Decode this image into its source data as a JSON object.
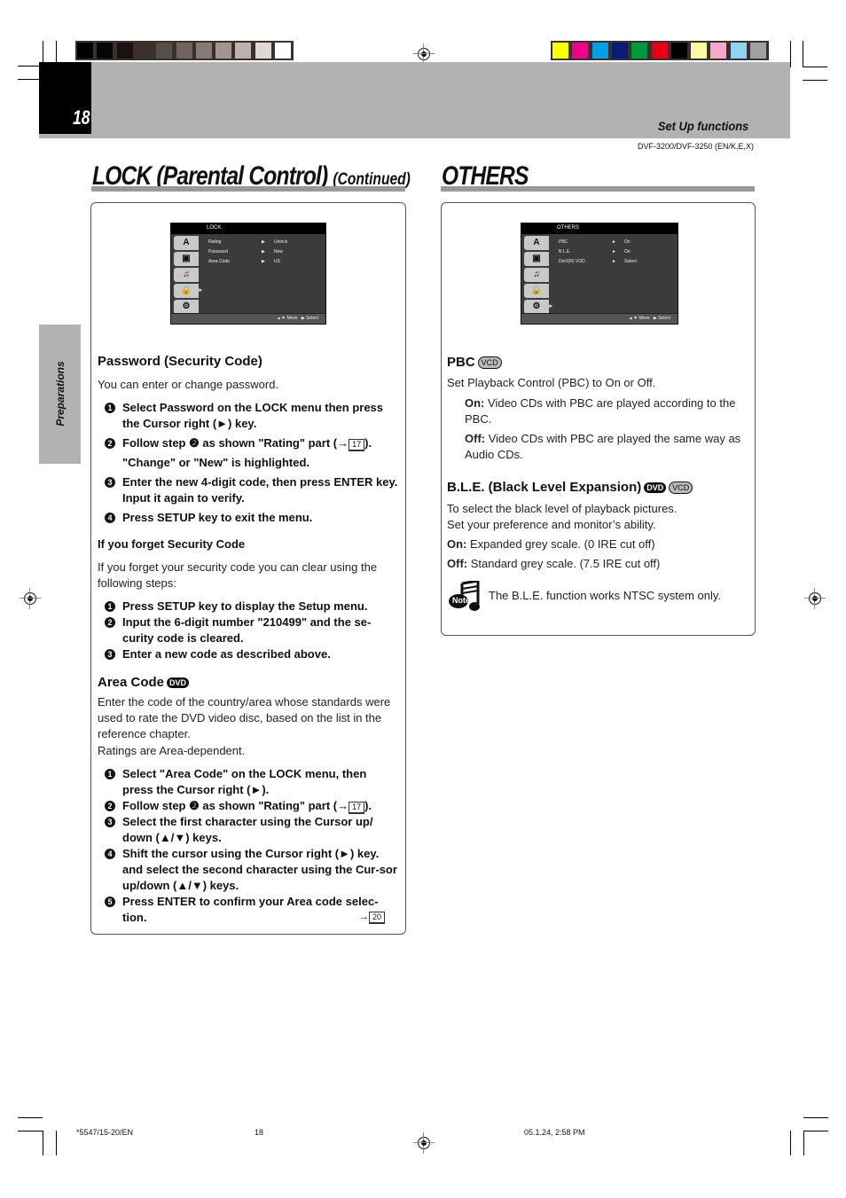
{
  "header": {
    "page_number": "18",
    "section": "Set Up functions",
    "model": "DVF-3200/DVF-3250 (EN/K,E,X)",
    "side_tab": "Preparations",
    "gray_swatches": [
      "#000000",
      "#050505",
      "#1a1210",
      "#3a302c",
      "#574d49",
      "#6f6460",
      "#857b77",
      "#a0958f",
      "#bcb2ae",
      "#ddd8d5",
      "#ffffff"
    ],
    "color_swatches": [
      "#ffff00",
      "#ec008c",
      "#00a0e9",
      "#0a1a7a",
      "#009a3e",
      "#e60012",
      "#000000",
      "#fff8a0",
      "#f5a8c8",
      "#8ed4f2",
      "#a0a0a0"
    ]
  },
  "left": {
    "title": "LOCK (Parental Control)",
    "title_suffix": "(Continued)",
    "menu": {
      "title": "LOCK",
      "rows": [
        {
          "label": "Rating",
          "arrow": "▶",
          "value": "Unlock"
        },
        {
          "label": "Password",
          "arrow": "▶",
          "value": "New"
        },
        {
          "label": "Area Code",
          "arrow": "▶",
          "value": "US"
        }
      ],
      "footer_move": "▲▼ Move",
      "footer_select": "▶ Select"
    },
    "password": {
      "heading": "Password (Security Code)",
      "intro": "You can enter or change password.",
      "steps": [
        {
          "n": "1",
          "text": "Select Password on the LOCK menu then press the Cursor right (►) key."
        },
        {
          "n": "2",
          "text": "Follow step ❷ as shown \"Rating\" part (→",
          "ref": "17",
          "after": ")."
        },
        {
          "n": "",
          "text": "\"Change\" or \"New\" is highlighted."
        },
        {
          "n": "3",
          "text": "Enter the new 4-digit code, then press ENTER key. Input it again to verify."
        },
        {
          "n": "4",
          "text": "Press SETUP key to exit the menu."
        }
      ]
    },
    "forget": {
      "heading": "If you forget Security Code",
      "intro": "If you forget your security code you can clear using the following steps:",
      "steps": [
        {
          "n": "1",
          "text": "Press SETUP key to display the Setup menu."
        },
        {
          "n": "2",
          "text": "Input the 6-digit number \"210499\" and the se-curity code is cleared."
        },
        {
          "n": "3",
          "text": "Enter a new code as described above."
        }
      ]
    },
    "area": {
      "heading": "Area Code",
      "badge": "DVD",
      "intro": "Enter the code of the country/area whose standards were used to rate the DVD video disc, based on the list in the reference chapter.",
      "intro2": "Ratings are Area-dependent.",
      "steps": [
        {
          "n": "1",
          "text": "Select \"Area Code\" on the LOCK menu, then press the Cursor right (►)."
        },
        {
          "n": "2",
          "text": "Follow step ❷ as shown \"Rating\" part (→",
          "ref": "17",
          "after": ")."
        },
        {
          "n": "3",
          "text": "Select the first character using the Cursor up/ down (▲/▼) keys."
        },
        {
          "n": "4",
          "text": "Shift the cursor using the Cursor right (►) key. and select the second character using the Cur-sor up/down (▲/▼) keys."
        },
        {
          "n": "5",
          "text": "Press ENTER to confirm your Area code selec-tion.",
          "ref": "20"
        }
      ]
    }
  },
  "right": {
    "title": "OTHERS",
    "menu": {
      "title": "OTHERS",
      "rows": [
        {
          "label": "PBC",
          "arrow": "►",
          "value": "On"
        },
        {
          "label": "B.L.E.",
          "arrow": "►",
          "value": "On"
        },
        {
          "label": "DivX(R) VOD",
          "arrow": "►",
          "value": "Select"
        }
      ],
      "footer_move": "▲▼ Move",
      "footer_select": "▶ Select"
    },
    "pbc": {
      "heading": "PBC",
      "badge": "VCD",
      "intro": "Set Playback Control (PBC) to On or Off.",
      "on_label": "On:",
      "on_text": "Video CDs with PBC are played according to the PBC.",
      "off_label": "Off:",
      "off_text": "Video CDs with PBC are played the same way as Audio CDs."
    },
    "ble": {
      "heading": "B.L.E. (Black Level Expansion)",
      "badge1": "DVD",
      "badge2": "VCD",
      "intro1": "To select the black level of playback pictures.",
      "intro2": "Set your preference and monitor’s ability.",
      "on_label": "On:",
      "on_text": "Expanded grey scale. (0 IRE cut off)",
      "off_label": "Off:",
      "off_text": "Standard grey scale. (7.5 IRE cut off)",
      "note_label": "Note",
      "note_text": "The B.L.E. function works NTSC system only."
    }
  },
  "footer": {
    "code": "*5547/15-20/EN",
    "page": "18",
    "datetime": "05.1.24, 2:58 PM"
  }
}
